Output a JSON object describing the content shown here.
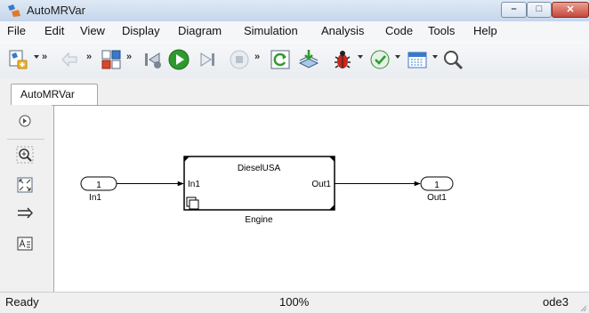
{
  "window": {
    "title": "AutoMRVar",
    "controls": {
      "minimize": "–",
      "maximize": "□",
      "close": "✕"
    }
  },
  "menu": [
    "File",
    "Edit",
    "View",
    "Display",
    "Diagram",
    "Simulation",
    "Analysis",
    "Code",
    "Tools",
    "Help"
  ],
  "toolbar": {
    "overflow": "»",
    "icons": [
      "new-model-icon",
      "back-icon",
      "model-browser-icon",
      "step-back-icon",
      "run-icon",
      "step-forward-icon",
      "stop-icon",
      "update-diagram-icon",
      "build-icon",
      "debug-icon",
      "model-advisor-icon",
      "data-inspector-icon",
      "zoom-icon"
    ]
  },
  "tabs": [
    {
      "label": "AutoMRVar"
    }
  ],
  "palette": [
    "hide-browser-icon",
    "zoom-in-icon",
    "fit-view-icon",
    "signal-arrow-icon",
    "annotation-icon"
  ],
  "diagram": {
    "inport": {
      "number": "1",
      "name": "In1"
    },
    "subsystem": {
      "title": "DieselUSA",
      "in_port": "In1",
      "out_port": "Out1",
      "name": "Engine"
    },
    "outport": {
      "number": "1",
      "name": "Out1"
    }
  },
  "status": {
    "left": "Ready",
    "zoom": "100%",
    "solver": "ode3"
  },
  "colors": {
    "accent": "#3a78c9",
    "run": "#2e9a2e",
    "close": "#c4483a"
  }
}
